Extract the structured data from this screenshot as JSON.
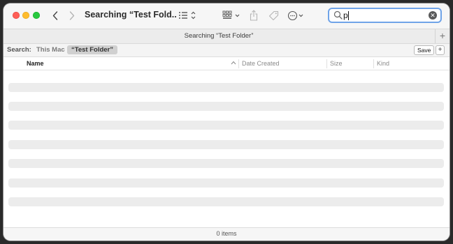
{
  "window": {
    "title": "Searching “Test Fold...",
    "tab_label": "Searching “Test Folder”"
  },
  "toolbar": {
    "back_icon": "chevron-left-icon",
    "forward_icon": "chevron-right-icon",
    "view_icon": "list-view-icon",
    "group_icon": "grid-group-icon",
    "share_icon": "share-icon",
    "tag_icon": "tag-icon",
    "action_icon": "ellipsis-circle-icon"
  },
  "search": {
    "value": "p",
    "placeholder": "Search"
  },
  "scope": {
    "label": "Search:",
    "this_mac": "This Mac",
    "folder": "“Test Folder”",
    "save_label": "Save",
    "add_label": "+"
  },
  "columns": {
    "name": "Name",
    "date_created": "Date Created",
    "size": "Size",
    "kind": "Kind"
  },
  "status": {
    "items": "0 items"
  },
  "colors": {
    "close": "#fe5f57",
    "minimize": "#febc2e",
    "zoom": "#28c840",
    "search_focus": "#6fa3e8",
    "placeholder_row": "#ececec"
  }
}
